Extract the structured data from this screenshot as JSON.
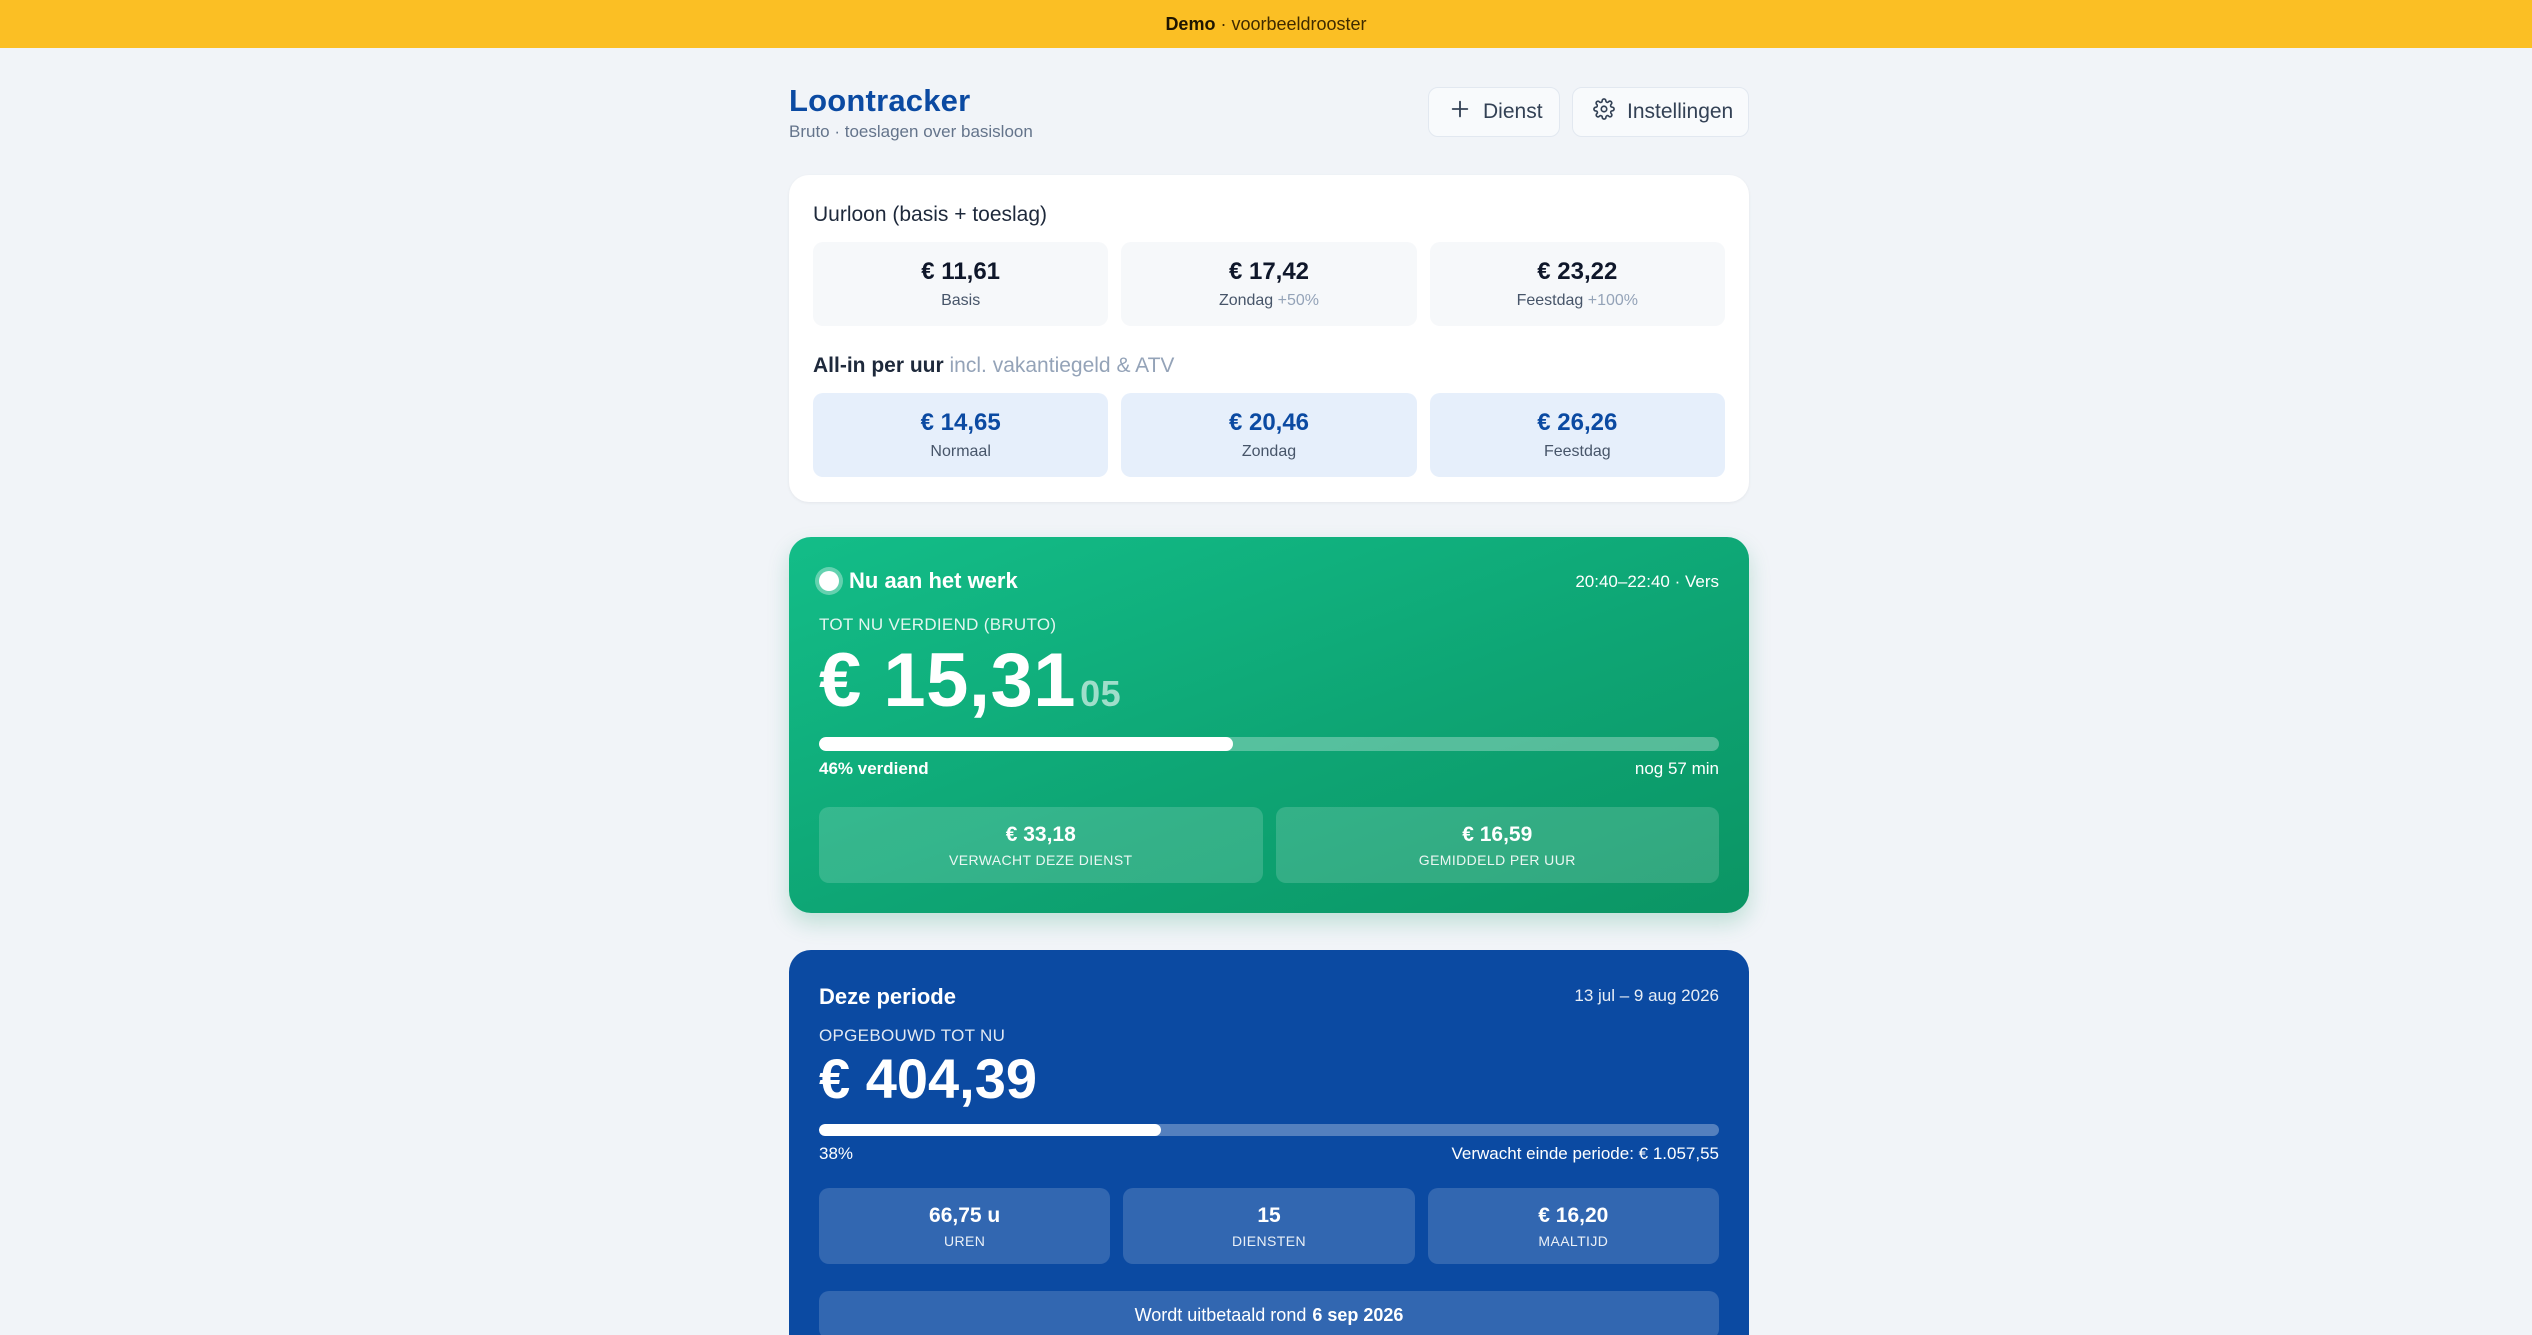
{
  "banner": {
    "strong": "Demo",
    "rest": "· voorbeeldrooster"
  },
  "header": {
    "title": "Loontracker",
    "subtitle": "Bruto · toeslagen over basisloon",
    "add_label": "Dienst",
    "settings_label": "Instellingen"
  },
  "rates": {
    "title": "Uurloon (basis + toeslag)",
    "items": [
      {
        "value": "€ 11,61",
        "label": "Basis",
        "extra": ""
      },
      {
        "value": "€ 17,42",
        "label": "Zondag",
        "extra": "+50%"
      },
      {
        "value": "€ 23,22",
        "label": "Feestdag",
        "extra": "+100%"
      }
    ],
    "allin_title": "All-in per uur",
    "allin_note": "incl. vakantiegeld & ATV",
    "allin": [
      {
        "value": "€ 14,65",
        "label": "Normaal"
      },
      {
        "value": "€ 20,46",
        "label": "Zondag"
      },
      {
        "value": "€ 26,26",
        "label": "Feestdag"
      }
    ]
  },
  "live": {
    "status": "Nu aan het werk",
    "time": "20:40–22:40 · Vers",
    "kicker": "TOT NU VERDIEND (BRUTO)",
    "amount": "€ 15,31",
    "cents": "05",
    "progress": 0.46,
    "progress_label": "46% verdiend",
    "remaining": "nog 57 min",
    "stats": [
      {
        "value": "€ 33,18",
        "label": "VERWACHT DEZE DIENST"
      },
      {
        "value": "€ 16,59",
        "label": "GEMIDDELD PER UUR"
      }
    ]
  },
  "period": {
    "title": "Deze periode",
    "range": "13 jul – 9 aug 2026",
    "kicker": "OPGEBOUWD TOT NU",
    "amount": "€ 404,39",
    "progress": 0.38,
    "progress_label": "38%",
    "expected": "Verwacht einde periode: € 1.057,55",
    "stats": [
      {
        "value": "66,75 u",
        "label": "UREN"
      },
      {
        "value": "15",
        "label": "DIENSTEN"
      },
      {
        "value": "€ 16,20",
        "label": "MAALTIJD"
      }
    ],
    "payout_prefix": "Wordt uitbetaald rond",
    "payout_date": "6 sep 2026"
  },
  "colors": {
    "banner": "#fbbf24",
    "brand_blue": "#0b4aa2",
    "live_green": "#10b07c",
    "background": "#f1f4f8"
  }
}
